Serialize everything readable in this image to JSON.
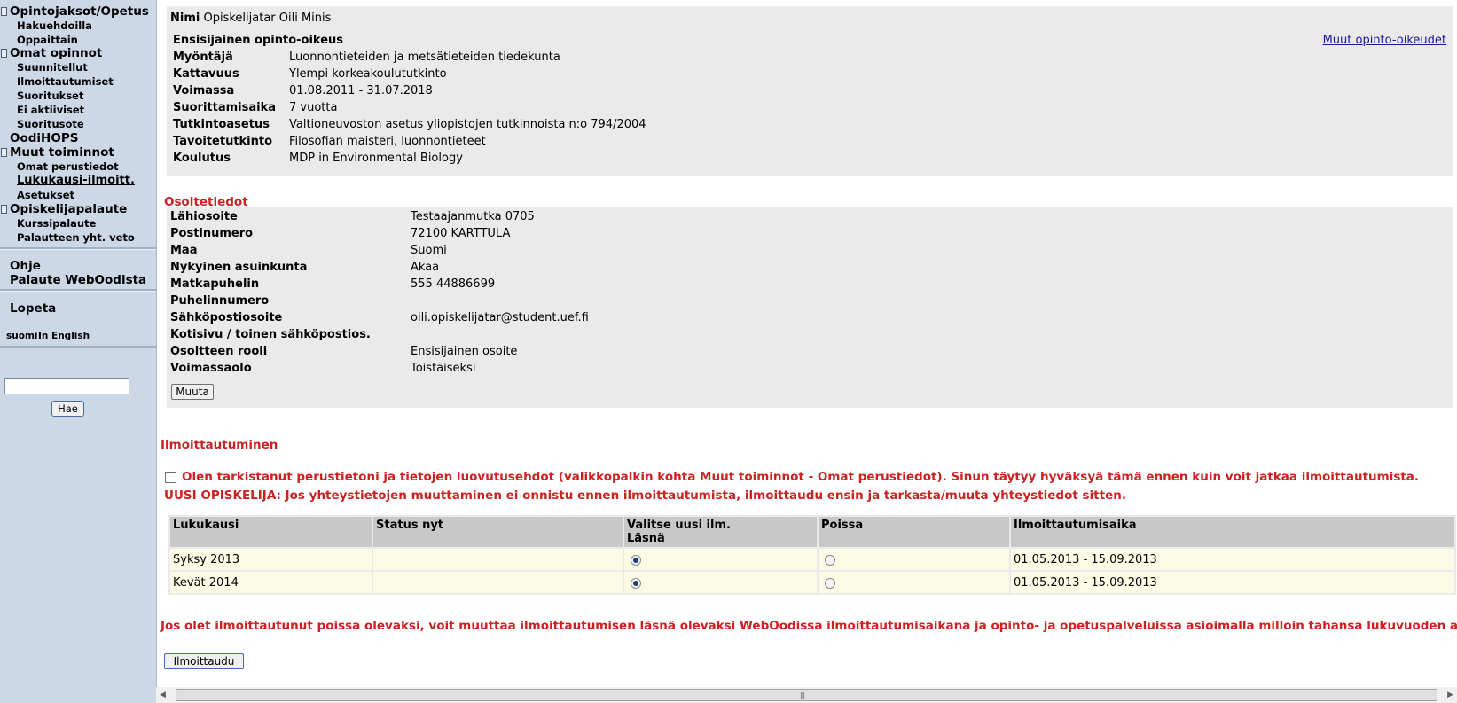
{
  "nav": {
    "top1": "Opintojaksot/Opetus",
    "top1_sub": [
      "Hakuehdoilla",
      "Oppaittain"
    ],
    "top2": "Omat opinnot",
    "top2_sub": [
      "Suunnitellut",
      "Ilmoittautumiset",
      "Suoritukset",
      "Ei aktiiviset",
      "Suoritusote"
    ],
    "top3": "OodiHOPS",
    "top4": "Muut toiminnot",
    "top4_sub": [
      "Omat perustiedot",
      "Lukukausi-ilmoitt.",
      "Asetukset"
    ],
    "top5": "Opiskelijapalaute",
    "top5_sub": [
      "Kurssipalaute",
      "Palautteen yht. veto"
    ],
    "help": "Ohje",
    "feedback": "Palaute WebOodista",
    "logout": "Lopeta",
    "lang_fi": "suomi",
    "lang_en": "In English",
    "search_button": "Hae"
  },
  "student": {
    "name_label": "Nimi",
    "name_value": "Opiskelijatar Oili Minis",
    "right_title": "Ensisijainen opinto-oikeus",
    "other_rights_link": "Muut opinto-oikeudet",
    "rows": [
      {
        "label": "Myöntäjä",
        "value": "Luonnontieteiden ja metsätieteiden tiedekunta"
      },
      {
        "label": "Kattavuus",
        "value": "Ylempi korkeakoulututkinto"
      },
      {
        "label": "Voimassa",
        "value": "01.08.2011 - 31.07.2018"
      },
      {
        "label": "Suorittamisaika",
        "value": "7 vuotta"
      },
      {
        "label": "Tutkintoasetus",
        "value": "Valtioneuvoston asetus yliopistojen tutkinnoista n:o 794/2004"
      },
      {
        "label": "Tavoitetutkinto",
        "value": "Filosofian maisteri, luonnontieteet"
      },
      {
        "label": "Koulutus",
        "value": "MDP in Environmental Biology"
      }
    ]
  },
  "address": {
    "title": "Osoitetiedot",
    "rows": [
      {
        "label": "Lähiosoite",
        "value": "Testaajanmutka 0705"
      },
      {
        "label": "Postinumero",
        "value": "72100 KARTTULA"
      },
      {
        "label": "Maa",
        "value": "Suomi"
      },
      {
        "label": "Nykyinen asuinkunta",
        "value": "Akaa"
      },
      {
        "label": "Matkapuhelin",
        "value": "555 44886699"
      },
      {
        "label": "Puhelinnumero",
        "value": ""
      },
      {
        "label": "Sähköpostiosoite",
        "value": "oili.opiskelijatar@student.uef.fi"
      },
      {
        "label": "Kotisivu / toinen sähköpostios.",
        "value": ""
      },
      {
        "label": "Osoitteen rooli",
        "value": "Ensisijainen osoite"
      },
      {
        "label": "Voimassaolo",
        "value": "Toistaiseksi"
      }
    ],
    "edit_button": "Muuta"
  },
  "registration": {
    "title": "Ilmoittautuminen",
    "confirm_text": "Olen tarkistanut perustietoni ja tietojen luovutusehdot (valikkopalkin kohta Muut toiminnot - Omat perustiedot). Sinun täytyy hyväksyä tämä ennen kuin voit jatkaa ilmoittautumista.",
    "new_student_text": "UUSI OPISKELIJA: Jos yhteystietojen muuttaminen ei onnistu ennen ilmoittautumista, ilmoittaudu ensin ja tarkasta/muuta yhteystiedot sitten.",
    "columns": [
      "Lukukausi",
      "Status nyt",
      "Valitse uusi ilm.",
      "Läsnä",
      "Poissa",
      "Ilmoittautumisaika"
    ],
    "terms": [
      {
        "term": "Syksy 2013",
        "status": "",
        "present": true,
        "absent": false,
        "period": "01.05.2013 - 15.09.2013"
      },
      {
        "term": "Kevät 2014",
        "status": "",
        "present": true,
        "absent": false,
        "period": "01.05.2013 - 15.09.2013"
      }
    ],
    "note": "Jos olet ilmoittautunut poissa olevaksi, voit muuttaa ilmoittautumisen läsnä olevaksi WebOodissa ilmoittautumisaikana ja opinto- ja opetuspalveluissa asioimalla milloin tahansa lukuvuoden aikana.",
    "submit_button": "Ilmoittaudu"
  },
  "icons": {
    "nav_bullet": "square-bullet-icon",
    "scroll_left": "arrow-left-icon",
    "scroll_right": "arrow-right-icon"
  }
}
